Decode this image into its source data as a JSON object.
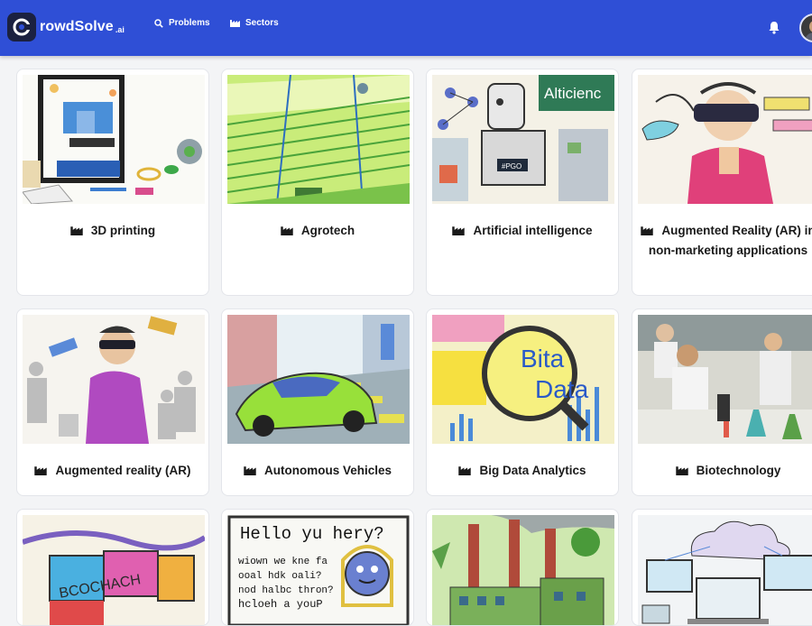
{
  "header": {
    "brand_main": "rowdSolve",
    "brand_suffix": ".ai",
    "nav": [
      {
        "label": "Problems",
        "icon": "search-icon"
      },
      {
        "label": "Sectors",
        "icon": "factory-icon"
      }
    ],
    "notifications_icon": "bell-icon",
    "accent_color": "#2f4fd6"
  },
  "sectors": [
    {
      "label": "3D printing",
      "icon": "factory-icon"
    },
    {
      "label": "Agrotech",
      "icon": "factory-icon"
    },
    {
      "label": "Artificial intelligence",
      "icon": "factory-icon"
    },
    {
      "label": "Augmented Reality (AR) in non-marketing applications",
      "icon": "factory-icon"
    },
    {
      "label": "Augmented reality (AR)",
      "icon": "factory-icon"
    },
    {
      "label": "Autonomous Vehicles",
      "icon": "factory-icon"
    },
    {
      "label": "Big Data Analytics",
      "icon": "factory-icon"
    },
    {
      "label": "Biotechnology",
      "icon": "factory-icon"
    },
    {
      "label": "",
      "icon": "factory-icon"
    },
    {
      "label": "",
      "icon": "factory-icon"
    },
    {
      "label": "",
      "icon": "factory-icon"
    },
    {
      "label": "",
      "icon": "factory-icon"
    }
  ],
  "image_text": {
    "ai": "Alticienc",
    "robot_badge": "#PGO",
    "bigdata_line1": "Bita",
    "bigdata_line2": "Data",
    "blockchain": "BCOCHACH",
    "hello_title": "Hello yu hery?",
    "hello_line1": "wiown we kne fa",
    "hello_line2": "ooal hdk oali?",
    "hello_line3": "nod halbc thron?",
    "hello_line4": "hcloeh a youP"
  }
}
